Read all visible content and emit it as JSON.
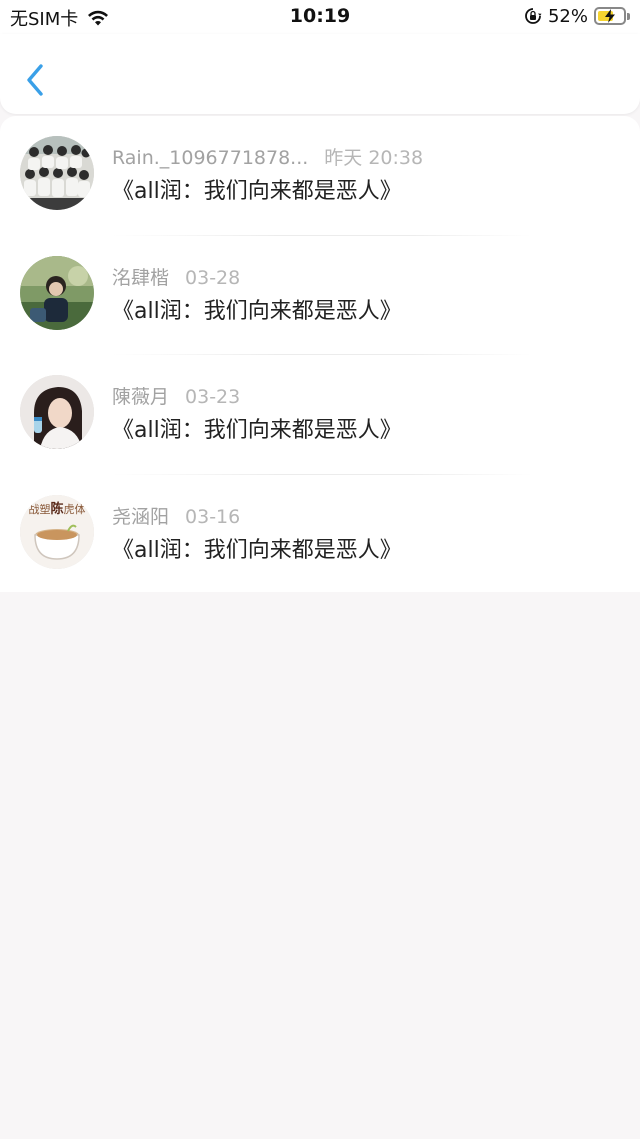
{
  "status_bar": {
    "carrier": "无SIM卡",
    "time": "10:19",
    "battery_percent": "52%",
    "battery_level": 0.52,
    "icons": [
      "wifi-icon",
      "orientation-lock-icon",
      "battery-charging-icon"
    ]
  },
  "navbar": {
    "back_icon": "chevron-left-icon",
    "accent_color": "#3aa0e8"
  },
  "items": [
    {
      "user": "Rain._1096771878...",
      "date": "昨天 20:38",
      "title": "《all润：我们向来都是恶人》"
    },
    {
      "user": "洺肆楷",
      "date": "03-28",
      "title": "《all润：我们向来都是恶人》"
    },
    {
      "user": "陳薇月",
      "date": "03-23",
      "title": "《all润：我们向来都是恶人》"
    },
    {
      "user": "尧涵阳",
      "date": "03-16",
      "title": "《all润：我们向来都是恶人》"
    }
  ],
  "avatar_badge_text": "战塑陈虎体"
}
